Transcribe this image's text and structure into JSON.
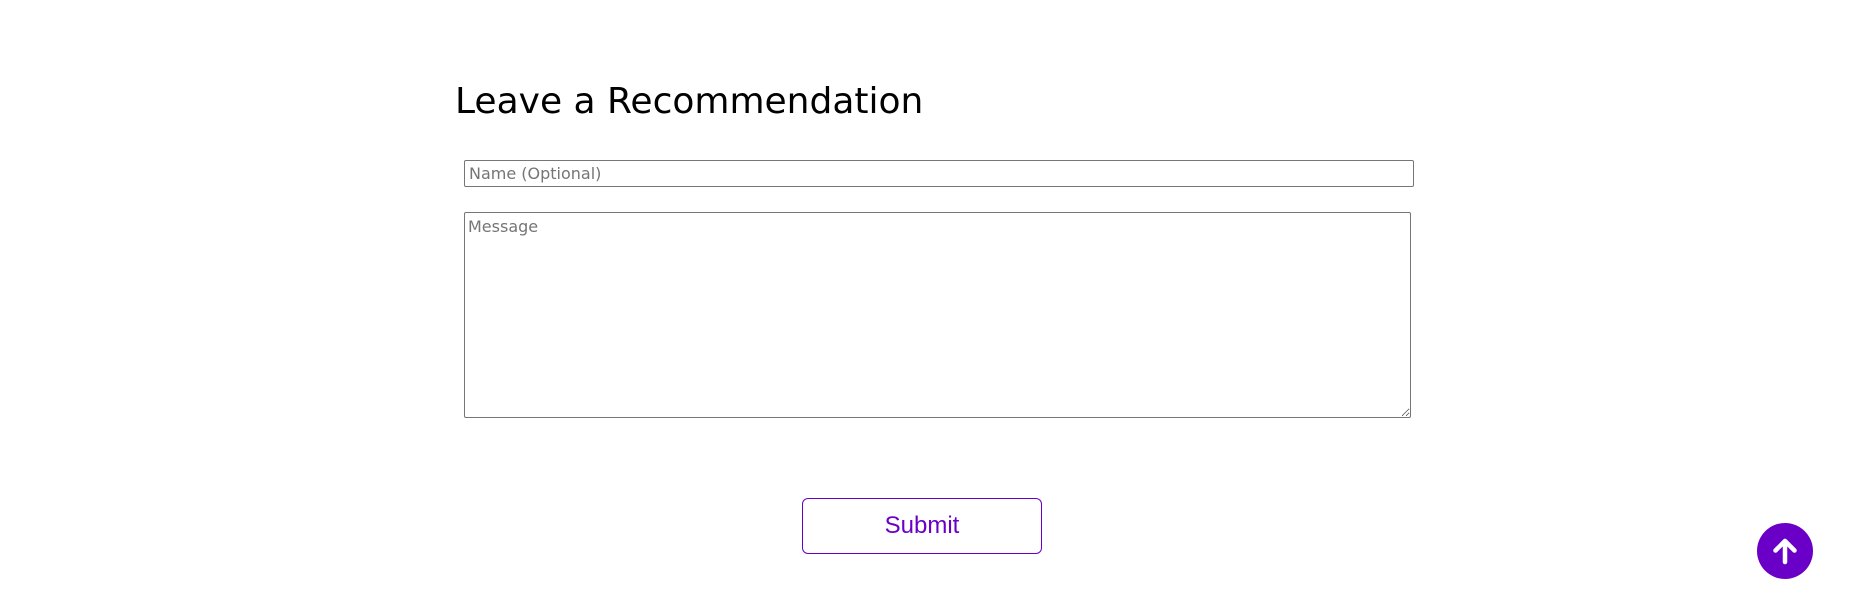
{
  "recommendation_form": {
    "heading": "Leave a Recommendation",
    "name_placeholder": "Name (Optional)",
    "name_value": "",
    "message_placeholder": "Message",
    "message_value": "",
    "submit_label": "Submit"
  },
  "scroll_top": {
    "icon": "arrow-up-icon"
  },
  "colors": {
    "accent": "#6a00c8",
    "field_border": "#767676",
    "placeholder": "#757575",
    "background": "#ffffff"
  }
}
